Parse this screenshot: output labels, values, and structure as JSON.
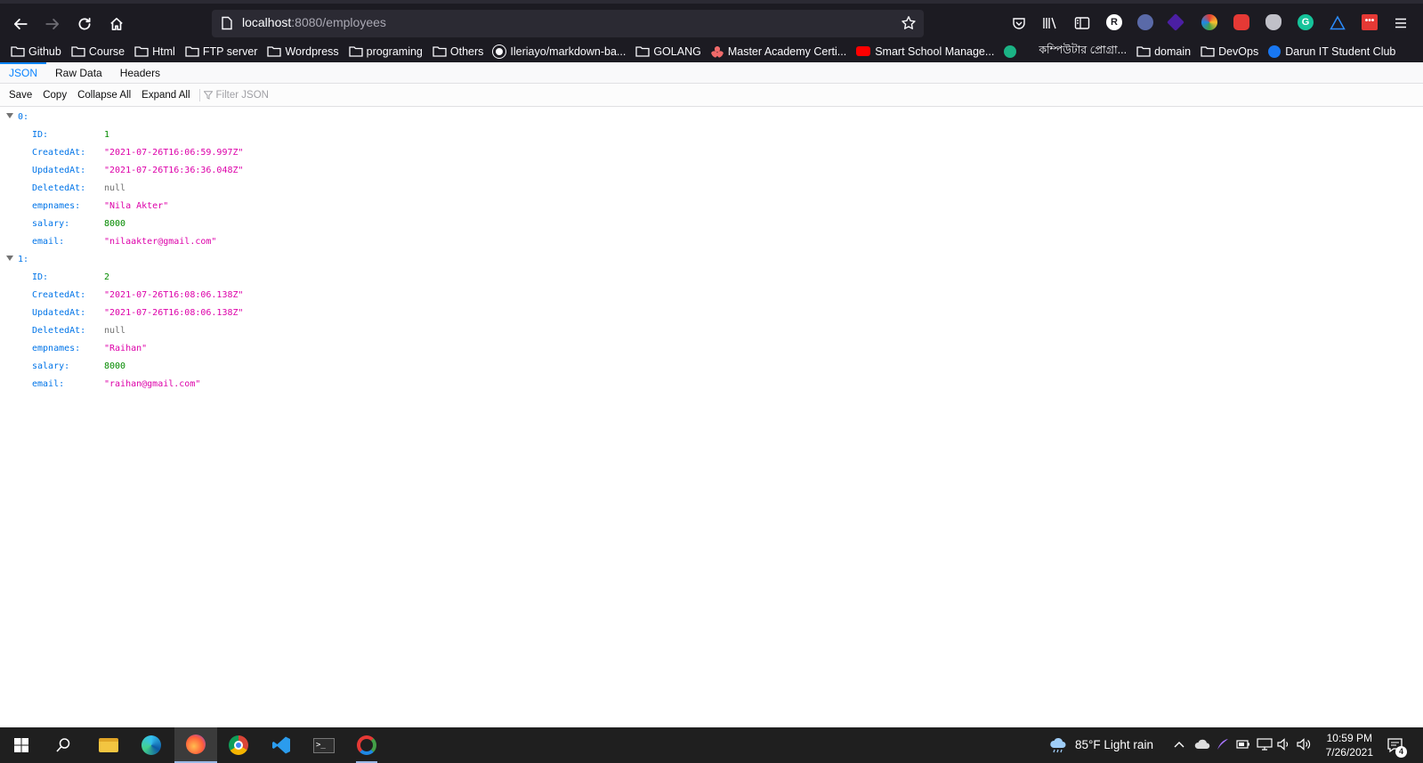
{
  "browser": {
    "url_host": "localhost",
    "url_rest": ":8080/employees"
  },
  "bookmarks": [
    {
      "label": "Github",
      "kind": "folder"
    },
    {
      "label": "Course",
      "kind": "folder"
    },
    {
      "label": "Html",
      "kind": "folder"
    },
    {
      "label": "FTP server",
      "kind": "folder"
    },
    {
      "label": "Wordpress",
      "kind": "folder"
    },
    {
      "label": "programing",
      "kind": "folder"
    },
    {
      "label": "Others",
      "kind": "folder"
    },
    {
      "label": "Ileriayo/markdown-ba...",
      "kind": "github"
    },
    {
      "label": "GOLANG",
      "kind": "folder"
    },
    {
      "label": "Master Academy Certi...",
      "kind": "asana"
    },
    {
      "label": "Smart School Manage...",
      "kind": "youtube"
    },
    {
      "label": "",
      "kind": "green-shield"
    },
    {
      "label": "কম্পিউটার প্রোগ্রা...",
      "kind": "none"
    },
    {
      "label": "domain",
      "kind": "folder"
    },
    {
      "label": "DevOps",
      "kind": "folder"
    },
    {
      "label": "Darun IT Student Club",
      "kind": "facebook"
    }
  ],
  "viewer": {
    "tabs": [
      "JSON",
      "Raw Data",
      "Headers"
    ],
    "active_tab": "JSON",
    "toolbar": {
      "save": "Save",
      "copy": "Copy",
      "collapse_all": "Collapse All",
      "expand_all": "Expand All",
      "filter_placeholder": "Filter JSON"
    }
  },
  "json": [
    {
      "index": "0:",
      "fields": [
        {
          "key": "ID:",
          "value": "1",
          "type": "num"
        },
        {
          "key": "CreatedAt:",
          "value": "\"2021-07-26T16:06:59.997Z\"",
          "type": "str"
        },
        {
          "key": "UpdatedAt:",
          "value": "\"2021-07-26T16:36:36.048Z\"",
          "type": "str"
        },
        {
          "key": "DeletedAt:",
          "value": "null",
          "type": "nul"
        },
        {
          "key": "empnames:",
          "value": "\"Nila Akter\"",
          "type": "str"
        },
        {
          "key": "salary:",
          "value": "8000",
          "type": "num"
        },
        {
          "key": "email:",
          "value": "\"nilaakter@gmail.com\"",
          "type": "str"
        }
      ]
    },
    {
      "index": "1:",
      "fields": [
        {
          "key": "ID:",
          "value": "2",
          "type": "num"
        },
        {
          "key": "CreatedAt:",
          "value": "\"2021-07-26T16:08:06.138Z\"",
          "type": "str"
        },
        {
          "key": "UpdatedAt:",
          "value": "\"2021-07-26T16:08:06.138Z\"",
          "type": "str"
        },
        {
          "key": "DeletedAt:",
          "value": "null",
          "type": "nul"
        },
        {
          "key": "empnames:",
          "value": "\"Raihan\"",
          "type": "str"
        },
        {
          "key": "salary:",
          "value": "8000",
          "type": "num"
        },
        {
          "key": "email:",
          "value": "\"raihan@gmail.com\"",
          "type": "str"
        }
      ]
    }
  ],
  "taskbar": {
    "weather": "85°F  Light rain",
    "time": "10:59 PM",
    "date": "7/26/2021",
    "notifications": "4"
  },
  "colors": {
    "chrome_bg": "#1c1b22",
    "url_bg": "#2b2a33",
    "json_key": "#0074e8",
    "json_string": "#dd00a9",
    "json_number": "#058b00",
    "json_null": "#737373",
    "accent": "#0a84ff"
  }
}
